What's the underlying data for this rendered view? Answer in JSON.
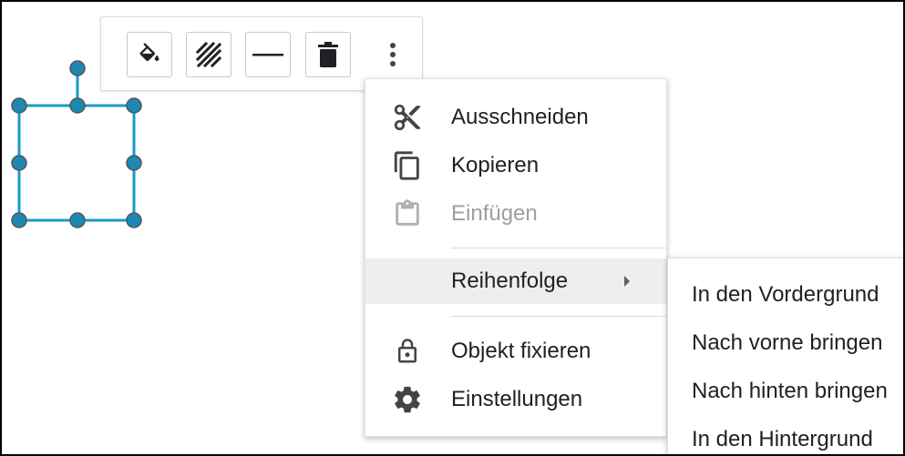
{
  "toolbar": {
    "buttons": [
      {
        "name": "fill-color-button",
        "icon": "paint-bucket-icon"
      },
      {
        "name": "border-style-button",
        "icon": "hatch-pattern-icon"
      },
      {
        "name": "line-weight-button",
        "icon": "horizontal-line-icon"
      },
      {
        "name": "delete-button",
        "icon": "trash-icon"
      }
    ],
    "more_icon": "more-vertical-icon"
  },
  "selection": {
    "color": "#1a9bc8",
    "handle_fill": "#1e88b4"
  },
  "context_menu": {
    "items": [
      {
        "label": "Ausschneiden",
        "icon": "scissors-icon",
        "disabled": false
      },
      {
        "label": "Kopieren",
        "icon": "copy-icon",
        "disabled": false
      },
      {
        "label": "Einfügen",
        "icon": "clipboard-icon",
        "disabled": true
      },
      {
        "label": "Reihenfolge",
        "icon": "",
        "has_submenu": true,
        "highlighted": true
      },
      {
        "label": "Objekt fixieren",
        "icon": "lock-icon",
        "disabled": false
      },
      {
        "label": "Einstellungen",
        "icon": "gear-icon",
        "disabled": false
      }
    ]
  },
  "submenu": {
    "items": [
      {
        "label": "In den Vordergrund"
      },
      {
        "label": "Nach vorne bringen"
      },
      {
        "label": "Nach hinten bringen"
      },
      {
        "label": "In den Hintergrund"
      }
    ]
  }
}
